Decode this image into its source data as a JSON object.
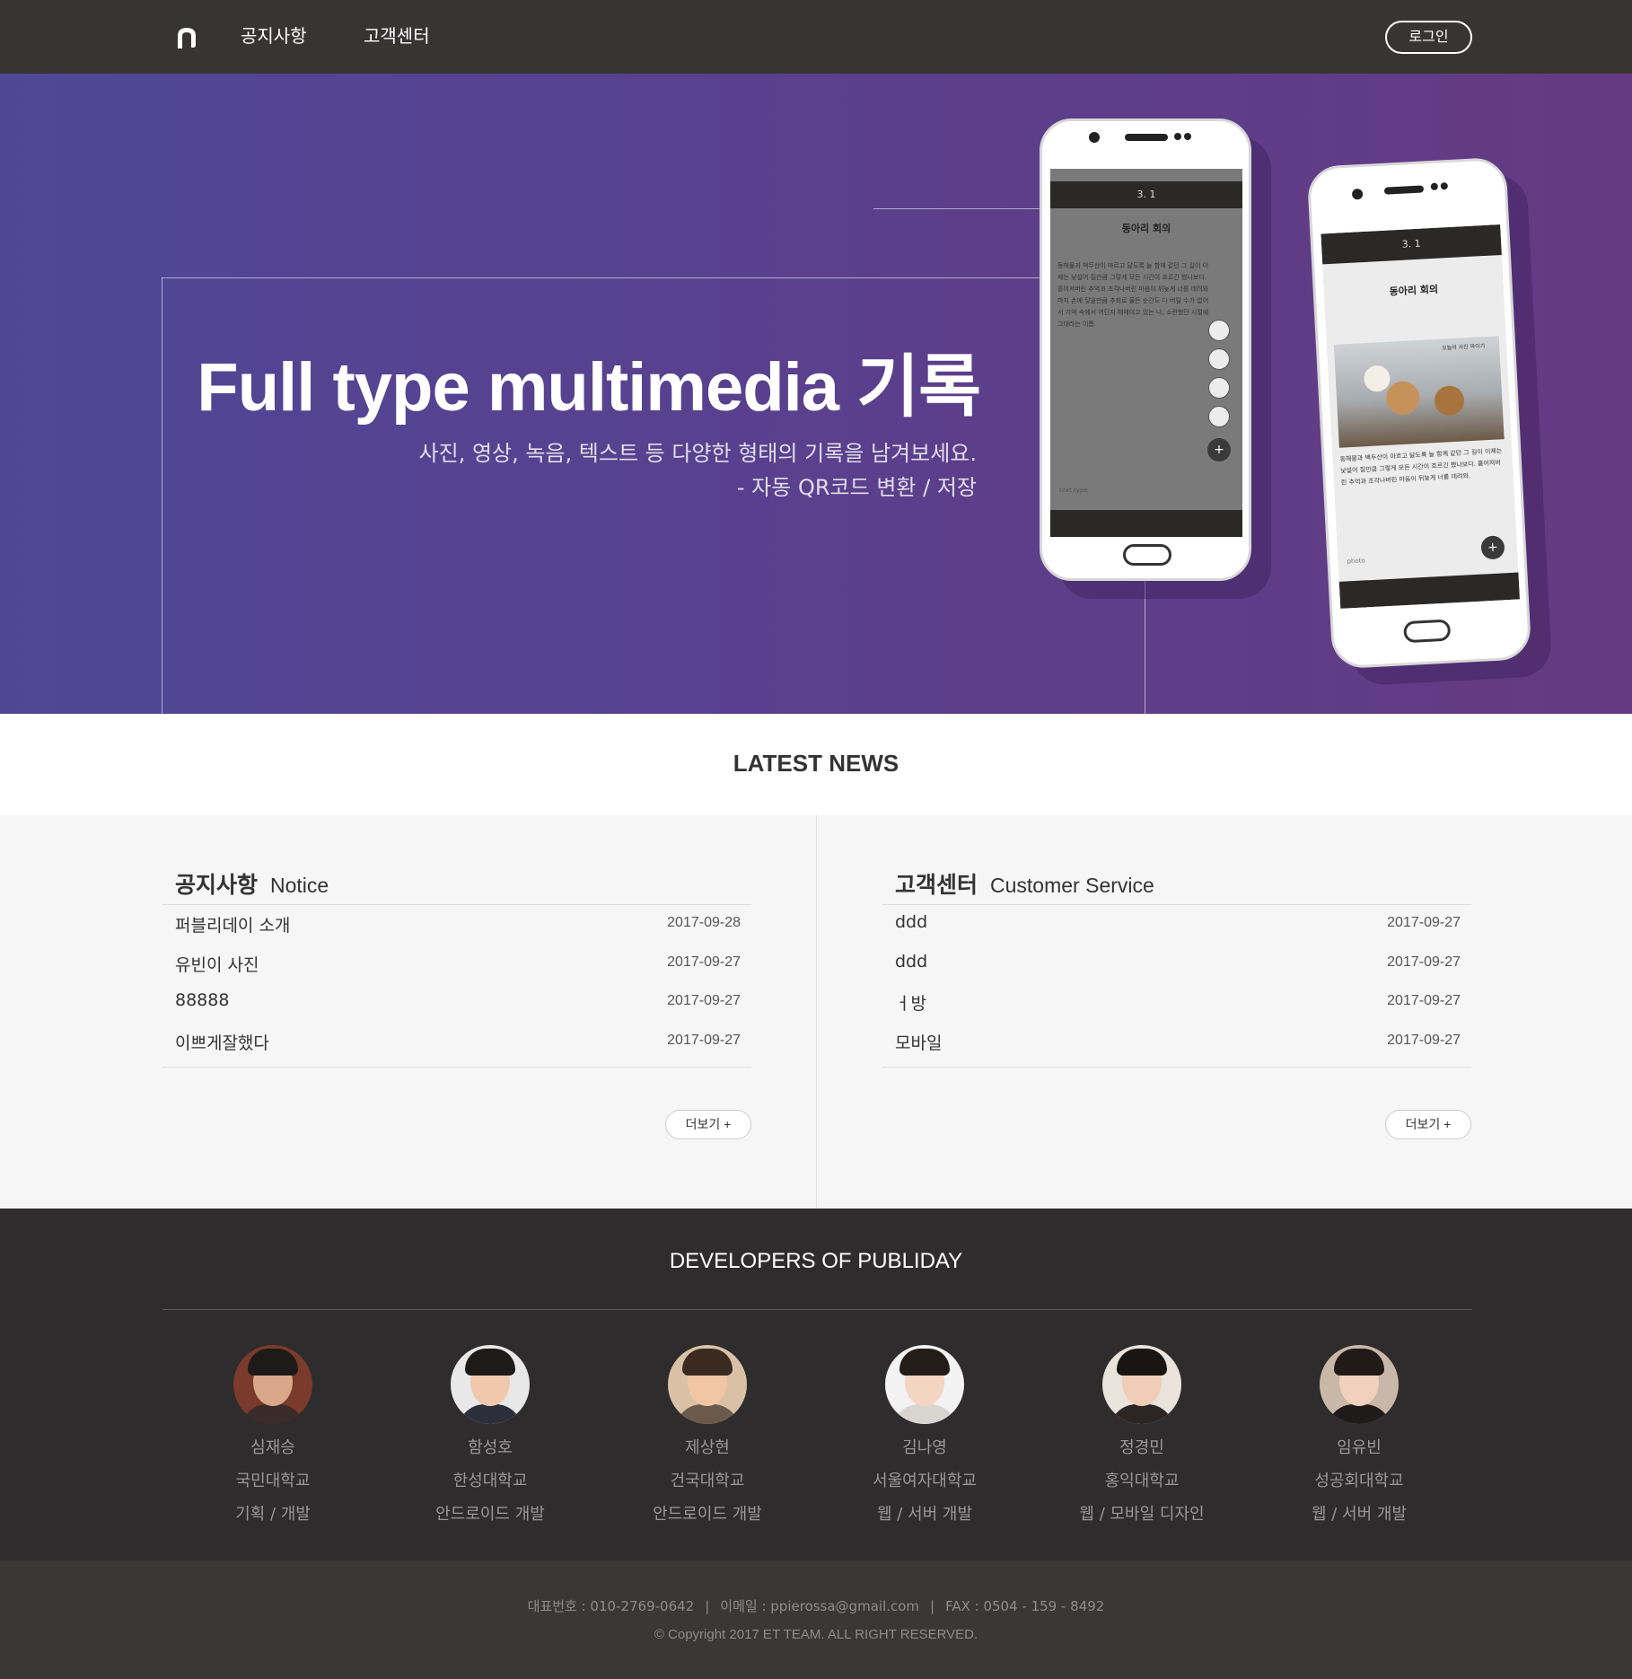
{
  "header": {
    "logo_icon": "publiday-logo-icon",
    "nav": [
      {
        "label": "공지사항"
      },
      {
        "label": "고객센터"
      }
    ],
    "login_label": "로그인"
  },
  "hero": {
    "title": "Full type multimedia 기록",
    "subtitle_line1": "사진, 영상, 녹음, 텍스트 등 다양한 형태의 기록을 남겨보세요.",
    "subtitle_line2": "- 자동 QR코드 변환 / 저장",
    "gradient_start": "#4f4796",
    "gradient_end": "#653a83",
    "phone_a": {
      "date": "3. 1",
      "heading": "동아리 회의",
      "body": "동해물과 백두산이 마르고 닳도록 늘 함께 같던 그 길이 이제는 낯설어 질만큼 그렇게 모든 시간이 흐르긴 했나보다. 흩어져버린 추억과 조각나버린 마음이 뒤늦게 너를 데려와 마지 손에 닿을만큼 추회로 물든 순간도 다 버릴 수가 없어서 기억 속에서 어딘지 헤매이고 있는 나, 소란했던 시절에 그대라는 이름.",
      "footer": "text type"
    },
    "phone_b": {
      "date": "3. 1",
      "heading": "동아리 회의",
      "body": "동해물과 백두산이 마르고 닳도록 늘 함께 같던 그 길이 이제는 낯설어 질만큼 그렇게 모든 시간이 흐르긴 했나보다. 흩어져버린 추억과 조각나버린 마음이 뒤늦게 너를 데려와.",
      "photo_caption": "오늘의 사진 파이기",
      "footer": "photo"
    }
  },
  "news": {
    "title": "LATEST NEWS",
    "notice": {
      "title_ko": "공지사항",
      "title_en": "Notice",
      "items": [
        {
          "title": "퍼블리데이 소개",
          "date": "2017-09-28"
        },
        {
          "title": "유빈이 사진",
          "date": "2017-09-27"
        },
        {
          "title": "88888",
          "date": "2017-09-27"
        },
        {
          "title": "이쁘게잘했다",
          "date": "2017-09-27"
        }
      ],
      "more_label": "더보기 +"
    },
    "support": {
      "title_ko": "고객센터",
      "title_en": "Customer Service",
      "items": [
        {
          "title": "ddd",
          "date": "2017-09-27"
        },
        {
          "title": "ddd",
          "date": "2017-09-27"
        },
        {
          "title": "ㅓ방",
          "date": "2017-09-27"
        },
        {
          "title": "모바일",
          "date": "2017-09-27"
        }
      ],
      "more_label": "더보기 +"
    }
  },
  "developers": {
    "title": "DEVELOPERS OF PUBLIDAY",
    "members": [
      {
        "name": "심재승",
        "school": "국민대학교",
        "role": "기획 / 개발"
      },
      {
        "name": "함성호",
        "school": "한성대학교",
        "role": "안드로이드 개발"
      },
      {
        "name": "제상현",
        "school": "건국대학교",
        "role": "안드로이드 개발"
      },
      {
        "name": "김나영",
        "school": "서울여자대학교",
        "role": "웹 / 서버 개발"
      },
      {
        "name": "정경민",
        "school": "홍익대학교",
        "role": "웹 / 모바일 디자인"
      },
      {
        "name": "임유빈",
        "school": "성공회대학교",
        "role": "웹 / 서버 개발"
      }
    ]
  },
  "footer": {
    "phone": "대표번호 : 010-2769-0642",
    "email": "이메일 : ppierossa@gmail.com",
    "fax": "FAX : 0504 - 159 - 8492",
    "separator": "|",
    "copyright": "© Copyright 2017 ET TEAM. ALL RIGHT RESERVED."
  }
}
